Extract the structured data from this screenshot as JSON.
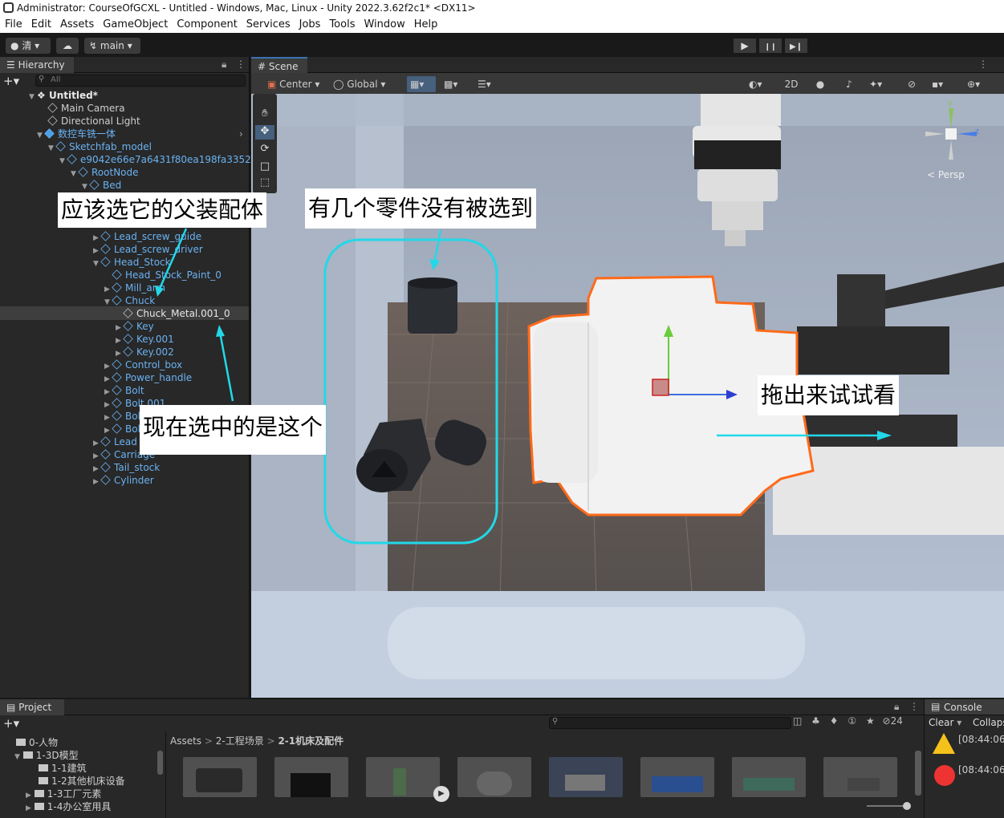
{
  "window": {
    "title": "Administrator: CourseOfGCXL - Untitled - Windows, Mac, Linux - Unity 2022.3.62f2c1* <DX11>"
  },
  "menu": [
    "File",
    "Edit",
    "Assets",
    "GameObject",
    "Component",
    "Services",
    "Jobs",
    "Tools",
    "Window",
    "Help"
  ],
  "toolbar": {
    "account": "清",
    "branch": "main",
    "play": "▶",
    "pause": "❙❙",
    "step": "▶❙"
  },
  "hierarchy": {
    "tab": "Hierarchy",
    "search_placeholder": "All",
    "rows": [
      "Untitled*",
      "Main Camera",
      "Directional Light",
      "数控车铣一体",
      "Sketchfab_model",
      "e9042e66e7a6431f80ea198fa3352",
      "RootNode",
      "Bed",
      "Lead_screw_guide",
      "Lead_screw_driver",
      "Head_Stock",
      "Head_Stock_Paint_0",
      "Mill_arm",
      "Chuck",
      "Chuck_Metal.001_0",
      "Key",
      "Key.001",
      "Key.002",
      "Control_box",
      "Power_handle",
      "Bolt",
      "Bolt.001",
      "Bolt.002",
      "Bolt.003",
      "Lead",
      "Carriage",
      "Tail_stock",
      "Cylinder"
    ]
  },
  "scene": {
    "tab": "Scene",
    "pivot": "Center",
    "space": "Global",
    "mode_2d": "2D",
    "persp": "Persp",
    "gizmo_y": "y",
    "gizmo_z": "z"
  },
  "annotations": {
    "parent_note": "应该选它的父装配体",
    "missing_note": "有几个零件没有被选到",
    "current_note": "现在选中的是这个",
    "drag_note": "拖出来试试看"
  },
  "project": {
    "tab": "Project",
    "breadcrumb": [
      "Assets",
      "2-工程场景",
      "2-1机床及配件"
    ],
    "hidden_count": "24",
    "folders": [
      "0-人物",
      "1-3D模型",
      "1-1建筑",
      "1-2其他机床设备",
      "1-3工厂元素",
      "1-4办公室用具"
    ]
  },
  "console": {
    "tab": "Console",
    "clear": "Clear",
    "collapse": "Collaps",
    "time1": "[08:44:06]",
    "time2": "[08:44:06]"
  }
}
